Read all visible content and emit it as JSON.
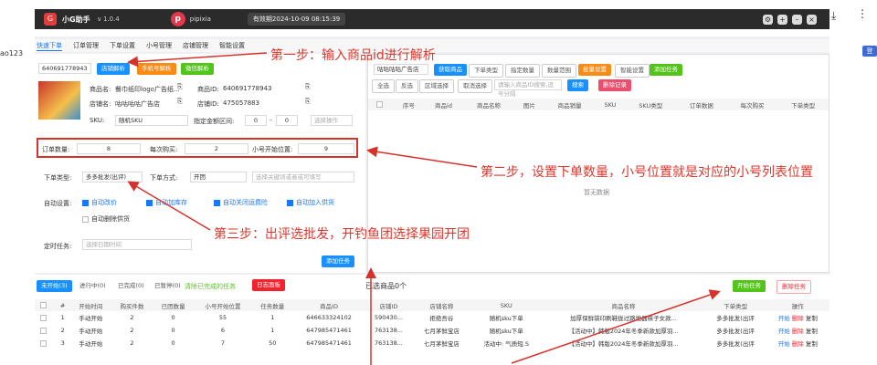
{
  "browser": {
    "left_text": "ao123",
    "download_icon": "download-icon",
    "menu_icon": "more-icon",
    "right_btn": "登"
  },
  "app": {
    "name": "小G助手",
    "version": "v 1.0.4",
    "partner": "pipixia",
    "expiry": "有效期2024-10-09 08:15:39"
  },
  "tabs": [
    "快速下单",
    "订单管理",
    "下单设置",
    "小号管理",
    "店铺管理",
    "智能设置"
  ],
  "left": {
    "product_id": "640691778943",
    "btn_store": "店铺解析",
    "btn_phone": "手机号解析",
    "btn_micro": "微信解析",
    "product_name_label": "商品名:",
    "product_name": "餐巾纸印logo广告纸...",
    "product_id_label": "商品ID:",
    "product_id_val": "640691778943",
    "shop_name_label": "店铺名:",
    "shop_name": "咕咕咕咕广告店",
    "shop_id_label": "店铺ID:",
    "shop_id": "475057883",
    "sku_label": "SKU:",
    "sku_value": "随机SKU",
    "price_range_label": "指定金额区间:",
    "price_from": "0",
    "price_to": "0",
    "price_select": "选择操作",
    "order_qty_label": "订单数量:",
    "order_qty": "8",
    "per_buy_label": "每次购买:",
    "per_buy": "2",
    "account_pos_label": "小号开始位置:",
    "account_pos": "9",
    "order_type_label": "下单类型:",
    "order_type": "多多批发(出评)",
    "order_mode_label": "下单方式:",
    "order_mode": "开团",
    "keyword_placeholder": "选择关键词或者或可填写",
    "auto_label": "自动设置:",
    "auto_opts": [
      "自动改价",
      "自动加库存",
      "自动关闭运费险",
      "自动加入供货",
      "自动删除供货"
    ],
    "timer_label": "定时任务:",
    "timer_placeholder": "选择日期时间",
    "add_task": "添加任务"
  },
  "right": {
    "shop_select": "咕咕咕咕广告店",
    "top_btns": [
      "获取商品",
      "下单类型",
      "指定数量",
      "数量范围",
      "批量设置",
      "智能设置",
      "添加任务"
    ],
    "second_btns": [
      "全选",
      "反选",
      "区域选择",
      "取消选择"
    ],
    "search_placeholder": "请输入商品ID搜索,逗号分隔",
    "search_btn": "搜索",
    "del_btn": "删除记录",
    "cols": [
      "",
      "序号",
      "商品id",
      "商品名称",
      "图片",
      "商品销量",
      "SKU",
      "SKU类型",
      "订单数据",
      "每次购买",
      "下单类型"
    ],
    "empty": "暂无数据"
  },
  "bottom": {
    "status_tabs": [
      "未开始(3)",
      "进行中(0)",
      "已完成(0)",
      "已暂停(0)"
    ],
    "clear_done": "清除已完成的任务",
    "log_btn": "日志面板",
    "selected": "已选商品0个",
    "start_btn": "开始任务",
    "delete_btn": "删除任务",
    "cols": [
      "",
      "#",
      "开始时间",
      "购买件数",
      "已团数量",
      "小号开始位置",
      "任务数量",
      "商品ID",
      "店铺ID",
      "店铺名称",
      "SKU",
      "商品名称",
      "下单类型",
      "操作"
    ],
    "rows": [
      [
        "1",
        "手动开始",
        "2",
        "0",
        "55",
        "1",
        "646633324102",
        "590430...",
        "拒绝吾谷",
        "随机sku下单",
        "加厚保鲜袋印刷鞋拢过路地器袜子女款...",
        "多多批发(出评"
      ],
      [
        "2",
        "手动开始",
        "2",
        "0",
        "6",
        "1",
        "647985471461",
        "763138...",
        "七月茅鲜宝店",
        "随机sku下单",
        "【活动中】韩版2024年冬季新款加厚羽...",
        "多多批发(出评"
      ],
      [
        "3",
        "手动开始",
        "2",
        "0",
        "7",
        "50",
        "647985471461",
        "763138...",
        "七月茅鲜宝店",
        "活动中: 气质短.S",
        "【活动中】韩版2024年冬季新款加厚羽...",
        "多多批发(出评"
      ]
    ],
    "row_ops": [
      "开始",
      "删除",
      "复制"
    ]
  },
  "annotations": {
    "step1": "第一步：输入商品id进行解析",
    "step2": "第二步，设置下单数量，小号位置就是对应的小号列表位置",
    "step3": "第三步：出评选批发，开钓鱼团选择果园开团"
  },
  "colors": {
    "accent": "#1890ff",
    "annotation": "#d6322c",
    "titlebar": "#2b2b2b"
  }
}
